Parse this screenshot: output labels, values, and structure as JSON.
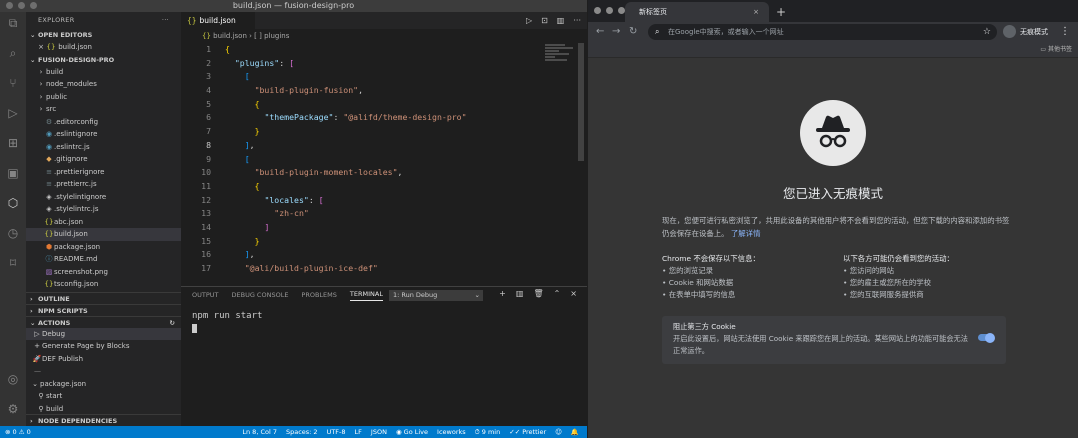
{
  "vscode": {
    "window_title": "build.json — fusion-design-pro",
    "explorer": {
      "title": "EXPLORER",
      "open_editors_label": "OPEN EDITORS",
      "open_editors": [
        {
          "name": "build.json"
        }
      ],
      "project_label": "FUSION-DESIGN-PRO",
      "tree": [
        {
          "name": "build",
          "type": "folder"
        },
        {
          "name": "node_modules",
          "type": "folder"
        },
        {
          "name": "public",
          "type": "folder"
        },
        {
          "name": "src",
          "type": "folder"
        },
        {
          "name": ".editorconfig",
          "type": "gear"
        },
        {
          "name": ".eslintignore",
          "type": "eslint"
        },
        {
          "name": ".eslintrc.js",
          "type": "eslint"
        },
        {
          "name": ".gitignore",
          "type": "git"
        },
        {
          "name": ".prettierignore",
          "type": "file"
        },
        {
          "name": ".prettierrc.js",
          "type": "file"
        },
        {
          "name": ".stylelintignore",
          "type": "stylelint"
        },
        {
          "name": ".stylelintrc.js",
          "type": "stylelint"
        },
        {
          "name": "abc.json",
          "type": "json"
        },
        {
          "name": "build.json",
          "type": "json",
          "selected": true
        },
        {
          "name": "package.json",
          "type": "pkg"
        },
        {
          "name": "README.md",
          "type": "md"
        },
        {
          "name": "screenshot.png",
          "type": "img"
        },
        {
          "name": "tsconfig.json",
          "type": "json"
        }
      ],
      "outline_label": "OUTLINE",
      "npm_scripts_label": "NPM SCRIPTS",
      "actions_label": "ACTIONS",
      "actions": [
        {
          "icon": "play-icon",
          "label": "Debug"
        },
        {
          "icon": "plus-icon",
          "label": "Generate Page by Blocks"
        },
        {
          "icon": "rocket-icon",
          "label": "DEF Publish"
        }
      ],
      "actions_divider": "—",
      "package_label": "package.json",
      "package_scripts": [
        "start",
        "build"
      ],
      "node_deps_label": "NODE DEPENDENCIES"
    },
    "editor": {
      "tab_label": "build.json",
      "breadcrumb": [
        "build.json",
        "[ ] plugins"
      ],
      "current_line": 8,
      "lines": [
        {
          "n": "1",
          "html": "<span class='b1'>{</span>"
        },
        {
          "n": "2",
          "html": "  <span class='k'>\"plugins\"</span><span class='p'>: </span><span class='b2'>[</span>"
        },
        {
          "n": "3",
          "html": "    <span class='b3'>[</span>"
        },
        {
          "n": "4",
          "html": "      <span class='s'>\"build-plugin-fusion\"</span><span class='p'>,</span>"
        },
        {
          "n": "5",
          "html": "      <span class='b1'>{</span>"
        },
        {
          "n": "6",
          "html": "        <span class='k'>\"themePackage\"</span><span class='p'>: </span><span class='s'>\"@alifd/theme-design-pro\"</span>"
        },
        {
          "n": "7",
          "html": "      <span class='b1'>}</span>"
        },
        {
          "n": "8",
          "html": "    <span class='b3'>]</span><span class='p'>,</span>"
        },
        {
          "n": "9",
          "html": "    <span class='b3'>[</span>"
        },
        {
          "n": "10",
          "html": "      <span class='s'>\"build-plugin-moment-locales\"</span><span class='p'>,</span>"
        },
        {
          "n": "11",
          "html": "      <span class='b1'>{</span>"
        },
        {
          "n": "12",
          "html": "        <span class='k'>\"locales\"</span><span class='p'>: </span><span class='b2'>[</span>"
        },
        {
          "n": "13",
          "html": "          <span class='s'>\"zh-cn\"</span>"
        },
        {
          "n": "14",
          "html": "        <span class='b2'>]</span>"
        },
        {
          "n": "15",
          "html": "      <span class='b1'>}</span>"
        },
        {
          "n": "16",
          "html": "    <span class='b3'>]</span><span class='p'>,</span>"
        },
        {
          "n": "17",
          "html": "    <span class='s'>\"@ali/build-plugin-ice-def\"</span>"
        }
      ]
    },
    "panel": {
      "tabs": [
        "OUTPUT",
        "DEBUG CONSOLE",
        "PROBLEMS",
        "TERMINAL"
      ],
      "active_tab": "TERMINAL",
      "terminal_select": "1: Run Debug",
      "terminal_text": "npm run start"
    },
    "statusbar": {
      "left": "⊗ 0  ⚠ 0",
      "items": [
        "Ln 8, Col 7",
        "Spaces: 2",
        "UTF-8",
        "LF",
        "JSON",
        "◉ Go Live",
        "Iceworks",
        "⏱ 9 min",
        "✓✓ Prettier",
        "☺",
        "🔔"
      ]
    }
  },
  "chrome": {
    "tab_title": "新标签页",
    "omnibox_placeholder": "在Google中搜索，或者输入一个网址",
    "profile_label": "无痕模式",
    "bookmarks_other": "其他书签",
    "ntp": {
      "title": "您已进入无痕模式",
      "para": "现在，您便可进行私密浏览了，共用此设备的其他用户将不会看到您的活动，但您下载的内容和添加的书签仍会保存在设备上。",
      "learn_more": "了解详情",
      "left_heading": "Chrome 不会保存以下信息：",
      "left_items": [
        "您的浏览记录",
        "Cookie 和网站数据",
        "在表单中填写的信息"
      ],
      "right_heading": "以下各方可能仍会看到您的活动：",
      "right_items": [
        "您访问的网站",
        "您的雇主或您所在的学校",
        "您的互联网服务提供商"
      ],
      "cookie_heading": "阻止第三方 Cookie",
      "cookie_text": "开启此设置后，网站无法使用 Cookie 来跟踪您在网上的活动。某些网站上的功能可能会无法正常运作。",
      "cookie_toggle_on": true
    }
  }
}
